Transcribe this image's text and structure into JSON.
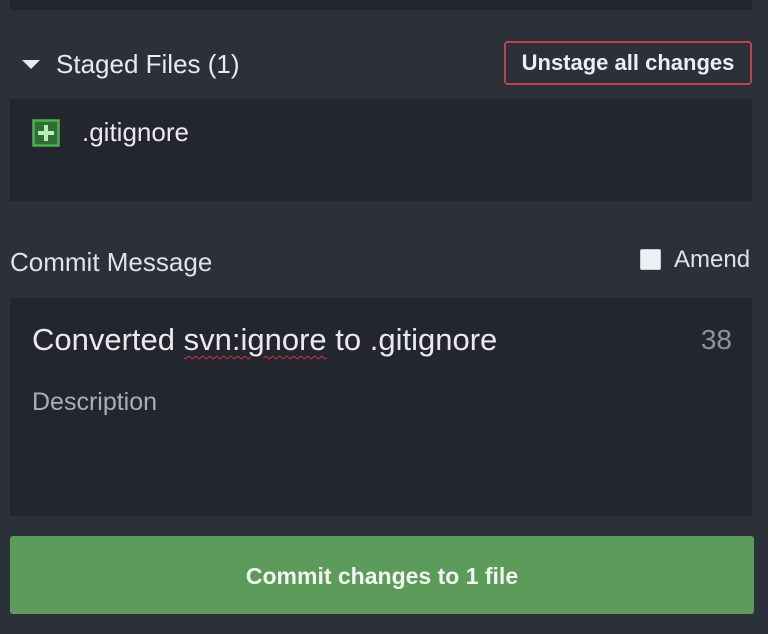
{
  "staged": {
    "title": "Staged Files (1)",
    "unstage_label": "Unstage all changes",
    "files": [
      {
        "name": ".gitignore",
        "status": "added",
        "icon": "plus-square-icon",
        "icon_color": "#4caf50"
      }
    ]
  },
  "commit": {
    "label": "Commit Message",
    "amend_label": "Amend",
    "amend_checked": false,
    "summary_prefix": "Converted ",
    "summary_misspelled": "svn:ignore",
    "summary_suffix": " to .gitignore",
    "char_count": "38",
    "description_placeholder": "Description",
    "button_label": "Commit changes to 1 file"
  },
  "colors": {
    "background": "#2c3039",
    "panel": "#23262e",
    "danger_border": "#c0424a",
    "commit_button": "#5c9b5a",
    "added_green": "#4caf50"
  }
}
